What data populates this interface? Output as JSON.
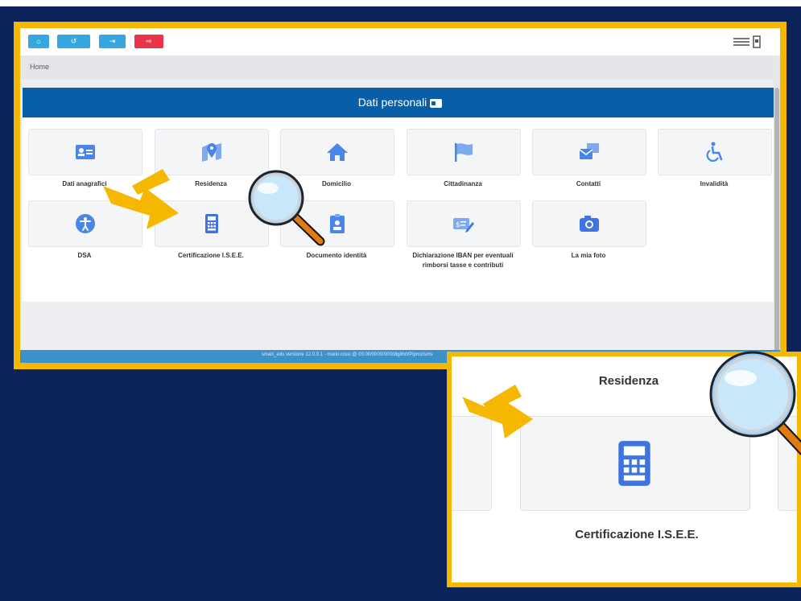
{
  "topbar": {
    "buttons": [
      {
        "icon": "home-icon",
        "glyph": "⌂",
        "color": "#35a6e0"
      },
      {
        "icon": "undo-icon",
        "glyph": "↺",
        "color": "#35a6e0"
      },
      {
        "icon": "switch-icon",
        "glyph": "⇥",
        "color": "#35a6e0"
      },
      {
        "icon": "logout-icon",
        "glyph": "⇨",
        "color": "#e8334a"
      }
    ],
    "logo": "school-logo-icon"
  },
  "breadcrumb": "Home",
  "panel": {
    "title": "Dati personali",
    "header_color": "#095ea8"
  },
  "tiles": [
    {
      "label": "Dati anagrafici",
      "icon": "id-card-icon"
    },
    {
      "label": "Residenza",
      "icon": "map-marker-icon"
    },
    {
      "label": "Domicilio",
      "icon": "home-icon"
    },
    {
      "label": "Cittadinanza",
      "icon": "flag-icon"
    },
    {
      "label": "Contatti",
      "icon": "envelope-icon"
    },
    {
      "label": "Invalidità",
      "icon": "wheelchair-icon"
    },
    {
      "label": "DSA",
      "icon": "accessibility-icon"
    },
    {
      "label": "Certificazione I.S.E.E.",
      "icon": "calculator-icon"
    },
    {
      "label": "Documento identità",
      "icon": "id-badge-icon"
    },
    {
      "label": "Dichiarazione IBAN per eventuali rimborsi tasse e contributi",
      "label_line1": "Dichiarazione IBAN per eventuali",
      "label_line2": "rimborsi tasse e contributi",
      "icon": "money-edit-icon"
    },
    {
      "label": "La mia foto",
      "icon": "camera-icon"
    }
  ],
  "footer": "smart_edu versione 12.0.0.1 - mario.rossi @ 00.00/0000/000/digithrt/Pipmz/sms",
  "zoom": {
    "title": "Residenza",
    "label": "Certificazione I.S.E.E.",
    "icon": "calculator-icon"
  },
  "annotations": {
    "arrow_color": "#f5b700",
    "frame_color": "#f5b700",
    "magnifier": "magnifier-icon"
  },
  "colors": {
    "background": "#0c2359",
    "accent": "#35a6e0",
    "icon_blue": "#4a86e8",
    "danger": "#e8334a"
  }
}
